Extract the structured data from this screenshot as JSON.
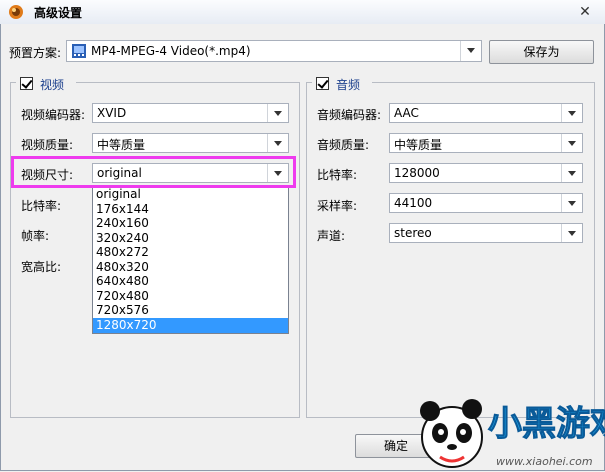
{
  "window": {
    "title": "高级设置"
  },
  "preset": {
    "label": "预置方案:",
    "value": "MP4-MPEG-4 Video(*.mp4)",
    "save_as": "保存为"
  },
  "video": {
    "group_title": "视频",
    "encoder": {
      "label": "视频编码器:",
      "value": "XVID"
    },
    "quality": {
      "label": "视频质量:",
      "value": "中等质量"
    },
    "size": {
      "label": "视频尺寸:",
      "value": "original"
    },
    "bitrate_label": "比特率:",
    "framerate_label": "帧率:",
    "aspect_label": "宽高比:",
    "size_options": [
      "original",
      "176x144",
      "240x160",
      "320x240",
      "480x272",
      "480x320",
      "640x480",
      "720x480",
      "720x576",
      "1280x720"
    ],
    "selected_option": "1280x720"
  },
  "audio": {
    "group_title": "音频",
    "encoder": {
      "label": "音频编码器:",
      "value": "AAC"
    },
    "quality": {
      "label": "音频质量:",
      "value": "中等质量"
    },
    "bitrate": {
      "label": "比特率:",
      "value": "128000"
    },
    "samplerate": {
      "label": "采样率:",
      "value": "44100"
    },
    "channels": {
      "label": "声道:",
      "value": "stereo"
    }
  },
  "footer": {
    "ok_label": "确定"
  },
  "watermark": {
    "text_cn": "小黑游戏",
    "url": "www.xiaohei.com"
  },
  "colors": {
    "highlight": "#ee3bee",
    "selection": "#3399ff"
  }
}
